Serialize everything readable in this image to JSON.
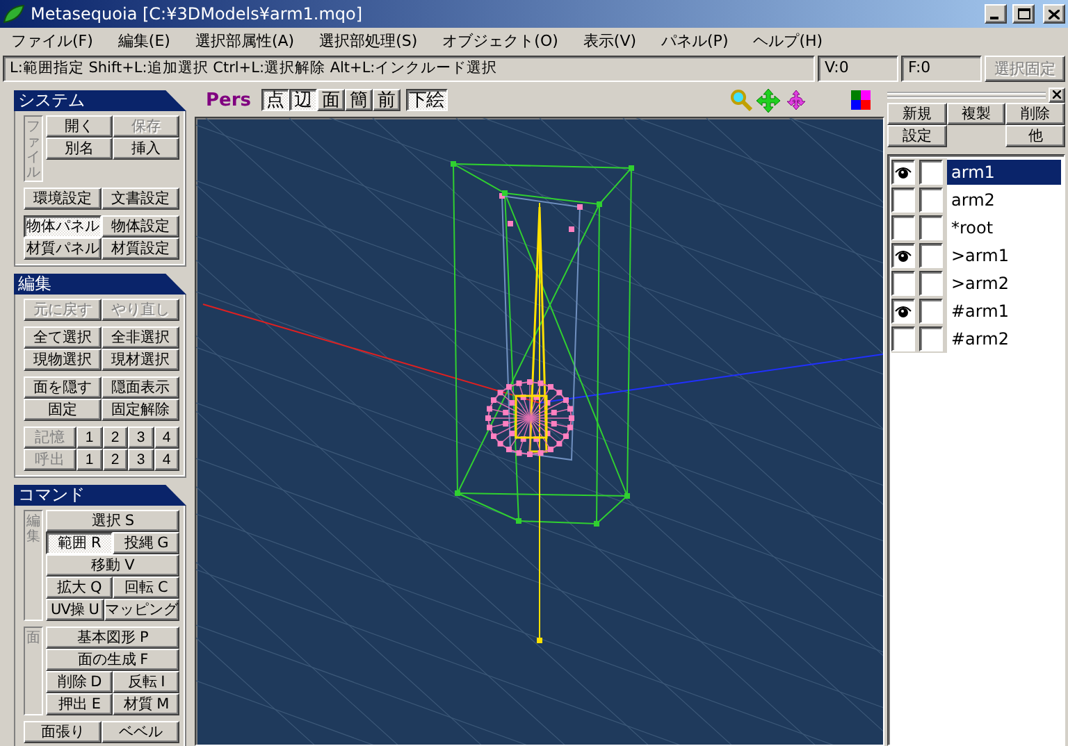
{
  "window": {
    "title": "Metasequoia [C:¥3DModels¥arm1.mqo]"
  },
  "menu": [
    "ファイル(F)",
    "編集(E)",
    "選択部属性(A)",
    "選択部処理(S)",
    "オブジェクト(O)",
    "表示(V)",
    "パネル(P)",
    "ヘルプ(H)"
  ],
  "hint_bar": {
    "text": "L:範囲指定  Shift+L:追加選択  Ctrl+L:選択解除  Alt+L:インクルード選択",
    "vertex_count": "V:0",
    "face_count": "F:0",
    "lock_button": {
      "label": "選択固定",
      "disabled": true
    }
  },
  "panels": [
    {
      "title": "システム",
      "sections": [
        {
          "kind": "buttons",
          "label": "ファイル",
          "rows": [
            [
              {
                "label": "開く",
                "pressed": false,
                "disabled": false
              },
              {
                "label": "保存",
                "pressed": false,
                "disabled": true
              }
            ],
            [
              {
                "label": "別名",
                "pressed": false,
                "disabled": false
              },
              {
                "label": "挿入",
                "pressed": false,
                "disabled": false
              }
            ]
          ]
        },
        {
          "kind": "buttons",
          "rows": [
            [
              {
                "label": "環境設定",
                "pressed": false,
                "disabled": false
              },
              {
                "label": "文書設定",
                "pressed": false,
                "disabled": false
              }
            ]
          ]
        },
        {
          "kind": "buttons",
          "rows": [
            [
              {
                "label": "物体パネル",
                "pressed": true,
                "disabled": false
              },
              {
                "label": "物体設定",
                "pressed": false,
                "disabled": false
              }
            ],
            [
              {
                "label": "材質パネル",
                "pressed": false,
                "disabled": false
              },
              {
                "label": "材質設定",
                "pressed": false,
                "disabled": false
              }
            ]
          ]
        }
      ]
    },
    {
      "title": "編集",
      "sections": [
        {
          "kind": "buttons",
          "rows": [
            [
              {
                "label": "元に戻す",
                "pressed": false,
                "disabled": true
              },
              {
                "label": "やり直し",
                "pressed": false,
                "disabled": true
              }
            ]
          ]
        },
        {
          "kind": "buttons",
          "rows": [
            [
              {
                "label": "全て選択",
                "pressed": false,
                "disabled": false
              },
              {
                "label": "全非選択",
                "pressed": false,
                "disabled": false
              }
            ],
            [
              {
                "label": "現物選択",
                "pressed": false,
                "disabled": false
              },
              {
                "label": "現材選択",
                "pressed": false,
                "disabled": false
              }
            ]
          ]
        },
        {
          "kind": "buttons",
          "rows": [
            [
              {
                "label": "面を隠す",
                "pressed": false,
                "disabled": false
              },
              {
                "label": "隠面表示",
                "pressed": false,
                "disabled": false
              }
            ],
            [
              {
                "label": "固定",
                "pressed": false,
                "disabled": false
              },
              {
                "label": "固定解除",
                "pressed": false,
                "disabled": false
              }
            ]
          ]
        },
        {
          "kind": "slots",
          "rows": [
            {
              "label": "記憶",
              "slots": [
                "1",
                "2",
                "3",
                "4"
              ]
            },
            {
              "label": "呼出",
              "slots": [
                "1",
                "2",
                "3",
                "4"
              ]
            }
          ]
        }
      ]
    },
    {
      "title": "コマンド",
      "sections": [
        {
          "kind": "buttons",
          "label": "編集",
          "rows": [
            [
              {
                "label": "選択 S",
                "pressed": false,
                "disabled": false
              }
            ],
            [
              {
                "label": "範囲 R",
                "pressed": true,
                "disabled": false
              },
              {
                "label": "投縄 G",
                "pressed": false,
                "disabled": false
              }
            ],
            [
              {
                "label": "移動 V",
                "pressed": false,
                "disabled": false
              }
            ],
            [
              {
                "label": "拡大 Q",
                "pressed": false,
                "disabled": false
              },
              {
                "label": "回転 C",
                "pressed": false,
                "disabled": false
              }
            ],
            [
              {
                "label": "UV操 U",
                "pressed": false,
                "disabled": false
              },
              {
                "label": "マッピング",
                "pressed": false,
                "disabled": false
              }
            ]
          ]
        },
        {
          "kind": "buttons",
          "label": "面",
          "rows": [
            [
              {
                "label": "基本図形 P",
                "pressed": false,
                "disabled": false
              }
            ],
            [
              {
                "label": "面の生成 F",
                "pressed": false,
                "disabled": false
              }
            ],
            [
              {
                "label": "削除 D",
                "pressed": false,
                "disabled": false
              },
              {
                "label": "反転 I",
                "pressed": false,
                "disabled": false
              }
            ],
            [
              {
                "label": "押出 E",
                "pressed": false,
                "disabled": false
              },
              {
                "label": "材質 M",
                "pressed": false,
                "disabled": false
              }
            ]
          ]
        },
        {
          "kind": "buttons",
          "rows": [
            [
              {
                "label": "面張り",
                "pressed": false,
                "disabled": false
              },
              {
                "label": "ベベル",
                "pressed": false,
                "disabled": false
              }
            ]
          ]
        }
      ]
    }
  ],
  "viewport": {
    "projection": "Pers",
    "toggles": [
      {
        "label": "点",
        "pressed": true
      },
      {
        "label": "辺",
        "pressed": true
      },
      {
        "label": "面",
        "pressed": false
      },
      {
        "label": "簡",
        "pressed": false
      },
      {
        "label": "前",
        "pressed": false
      }
    ],
    "underlay": {
      "label": "下絵",
      "pressed": true
    }
  },
  "object_panel": {
    "buttons": [
      [
        "新規",
        "複製",
        "削除"
      ],
      [
        "設定",
        "他"
      ]
    ],
    "objects": [
      {
        "name": "arm1",
        "visible": true,
        "selected": true
      },
      {
        "name": "arm2",
        "visible": false,
        "selected": false
      },
      {
        "name": "*root",
        "visible": false,
        "selected": false
      },
      {
        "name": ">arm1",
        "visible": true,
        "selected": false
      },
      {
        "name": ">arm2",
        "visible": false,
        "selected": false
      },
      {
        "name": "#arm1",
        "visible": true,
        "selected": false
      },
      {
        "name": "#arm2",
        "visible": false,
        "selected": false
      }
    ]
  }
}
